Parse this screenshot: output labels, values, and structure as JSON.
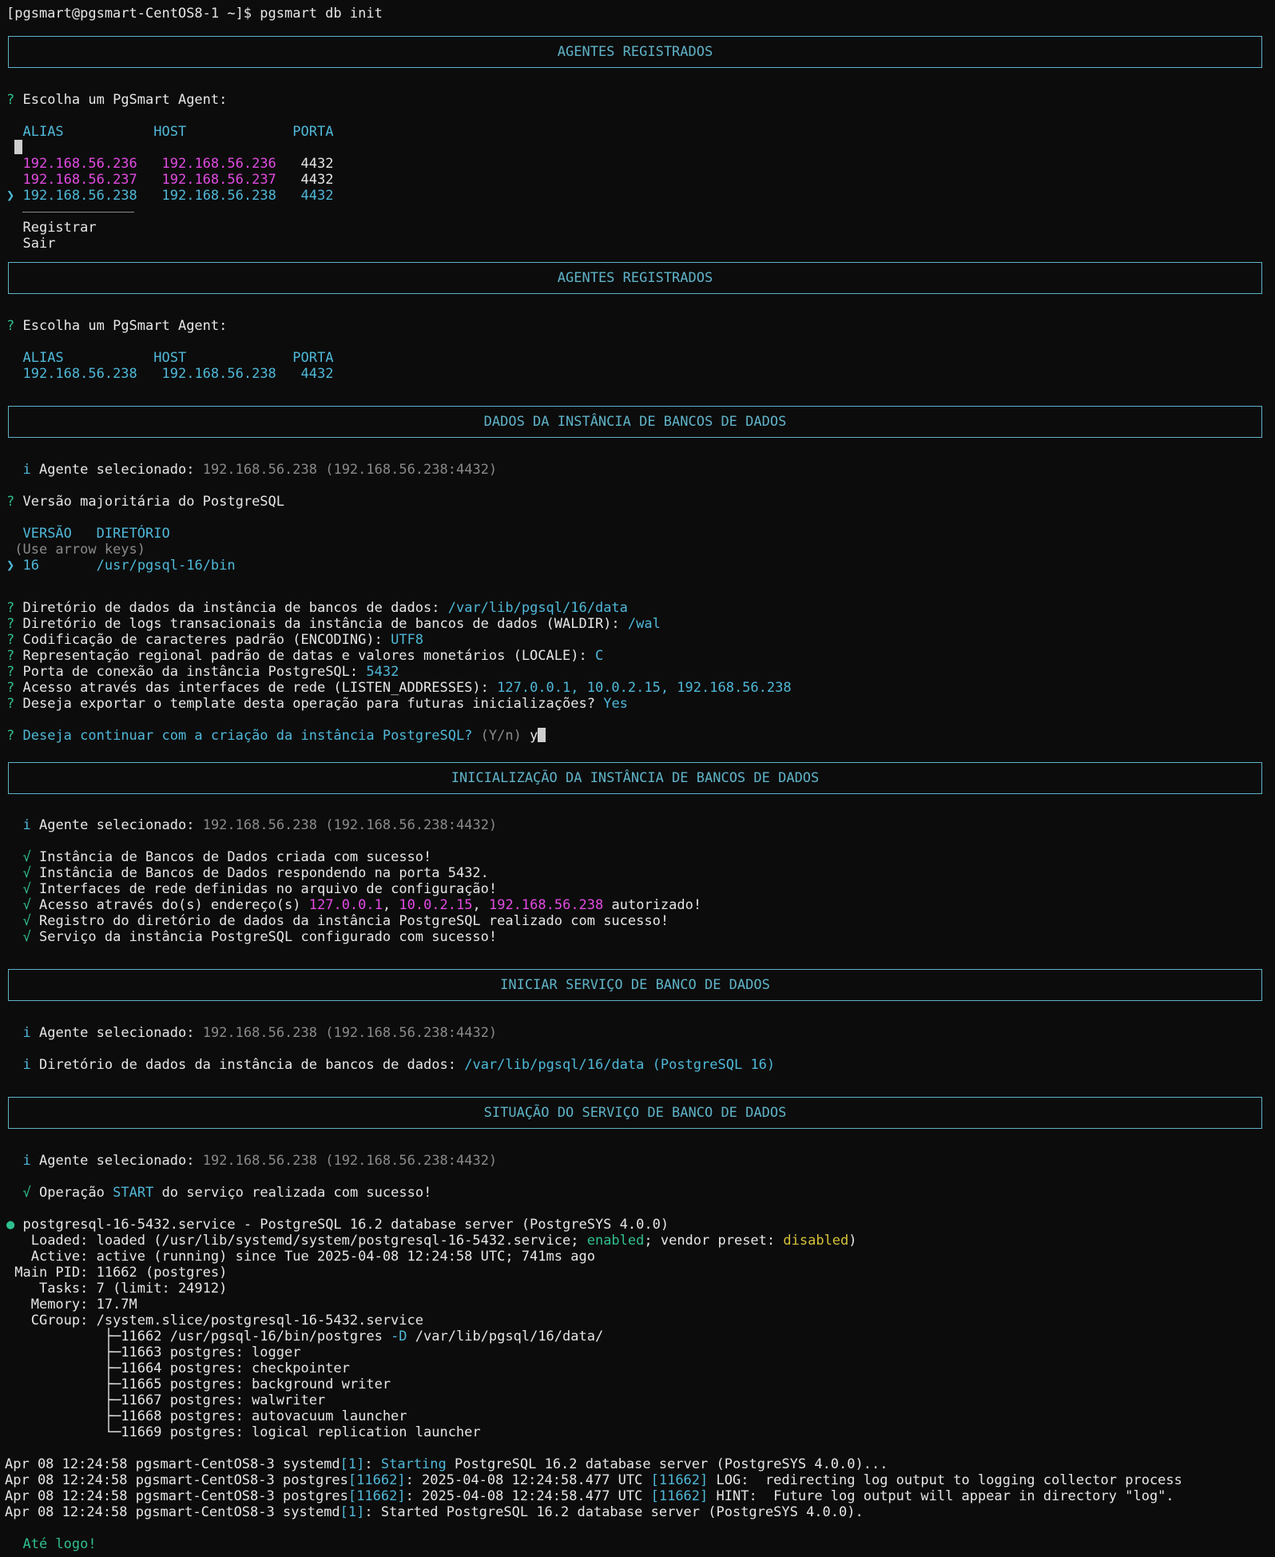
{
  "shell": {
    "prompt": "[pgsmart@pgsmart-CentOS8-1 ~]$ pgsmart db init"
  },
  "boxes": {
    "agents": "AGENTES REGISTRADOS",
    "instance_data": "DADOS DA INSTÂNCIA DE BANCOS DE DADOS",
    "init": "INICIALIZAÇÃO DA INSTÂNCIA DE BANCOS DE DADOS",
    "start": "INICIAR SERVIÇO DE BANCO DE DADOS",
    "status": "SITUAÇÃO DO SERVIÇO DE BANCO DE DADOS"
  },
  "agent_select": {
    "question": "Escolha um PgSmart Agent:",
    "headers": {
      "alias": "ALIAS",
      "host": "HOST",
      "port": "PORTA"
    },
    "rows": [
      {
        "alias": "192.168.56.236",
        "host": "192.168.56.236",
        "port": "4432"
      },
      {
        "alias": "192.168.56.237",
        "host": "192.168.56.237",
        "port": "4432"
      },
      {
        "alias": "192.168.56.238",
        "host": "192.168.56.238",
        "port": "4432"
      }
    ],
    "extra": [
      "Registrar",
      "Sair"
    ]
  },
  "agent_selected": {
    "alias": "192.168.56.238",
    "host": "192.168.56.238",
    "port": "4432"
  },
  "selected_agent_label": "Agente selecionado:",
  "selected_agent_value": "192.168.56.238 (192.168.56.238:4432)",
  "version": {
    "question": "Versão majoritária do PostgreSQL",
    "headers": {
      "version": "VERSÃO",
      "dir": "DIRETÓRIO"
    },
    "hint": "(Use arrow keys)",
    "option": {
      "version": "16",
      "dir": "/usr/pgsql-16/bin"
    }
  },
  "questions": [
    {
      "q": "Diretório de dados da instância de bancos de dados:",
      "a": "/var/lib/pgsql/16/data"
    },
    {
      "q": "Diretório de logs transacionais da instância de bancos de dados (WALDIR):",
      "a": "/wal"
    },
    {
      "q": "Codificação de caracteres padrão (ENCODING):",
      "a": "UTF8"
    },
    {
      "q": "Representação regional padrão de datas e valores monetários (LOCALE):",
      "a": "C"
    },
    {
      "q": "Porta de conexão da instância PostgreSQL:",
      "a": "5432"
    },
    {
      "q": "Acesso através das interfaces de rede (LISTEN_ADDRESSES):",
      "a": "127.0.0.1, 10.0.2.15, 192.168.56.238"
    },
    {
      "q": "Deseja exportar o template desta operação para futuras inicializações?",
      "a": "Yes"
    }
  ],
  "confirm": {
    "q": "Deseja continuar com a criação da instância PostgreSQL?",
    "hint": "(Y/n)",
    "answer": "y"
  },
  "init_results": {
    "r1": "Instância de Bancos de Dados criada com sucesso!",
    "r2": "Instância de Bancos de Dados respondendo na porta 5432.",
    "r3": "Interfaces de rede definidas no arquivo de configuração!",
    "r4a": "Acesso através do(s) endereço(s)",
    "addr1": "127.0.0.1",
    "addr2": "10.0.2.15",
    "addr3": "192.168.56.238",
    "r4b": "autorizado!",
    "r5": "Registro do diretório de dados da instância PostgreSQL realizado com sucesso!",
    "r6": "Serviço da instância PostgreSQL configurado com sucesso!"
  },
  "start_info": {
    "label": "Diretório de dados da instância de bancos de dados:",
    "value": "/var/lib/pgsql/16/data (PostgreSQL 16)"
  },
  "status_op": {
    "pre": "Operação",
    "op": "START",
    "post": "do serviço realizada com sucesso!"
  },
  "systemctl": {
    "title": "postgresql-16-5432.service - PostgreSQL 16.2 database server (PostgreSYS 4.0.0)",
    "loaded_pre": "  Loaded: loaded (/usr/lib/systemd/system/postgresql-16-5432.service;",
    "enabled": "enabled",
    "loaded_mid": "; vendor preset:",
    "disabled": "disabled",
    "active": "  Active: active (running) since Tue 2025-04-08 12:24:58 UTC; 741ms ago",
    "pid": "Main PID: 11662 (postgres)",
    "tasks": "   Tasks: 7 (limit: 24912)",
    "memory": "  Memory: 17.7M",
    "cgroup": "  CGroup: /system.slice/postgresql-16-5432.service",
    "tree": [
      "├─11662 /usr/pgsql-16/bin/postgres ",
      "├─11663 postgres: logger",
      "├─11664 postgres: checkpointer",
      "├─11665 postgres: background writer",
      "├─11667 postgres: walwriter",
      "├─11668 postgres: autovacuum launcher",
      "└─11669 postgres: logical replication launcher"
    ],
    "flag": "-D",
    "datadir": "/var/lib/pgsql/16/data/"
  },
  "journal": {
    "prefix": "Apr 08 12:24:58 pgsmart-CentOS8-3",
    "l1_proc": "systemd",
    "l1_pid": "[1]",
    "l1_kw": "Starting",
    "l1_rest": " PostgreSQL 16.2 database server (PostgreSYS 4.0.0)...",
    "l2_proc": "postgres",
    "l2_pid": "[11662]",
    "l2_ts": ": 2025-04-08 12:24:58.477 UTC ",
    "l2_pid2": "[11662]",
    "l2_rest": " LOG:  redirecting log output to logging collector process",
    "l3_rest": " HINT:  Future log output will appear in directory \"log\".",
    "l4_rest": ": Started PostgreSQL 16.2 database server (PostgreSYS 4.0.0)."
  },
  "goodbye": "Até logo!"
}
